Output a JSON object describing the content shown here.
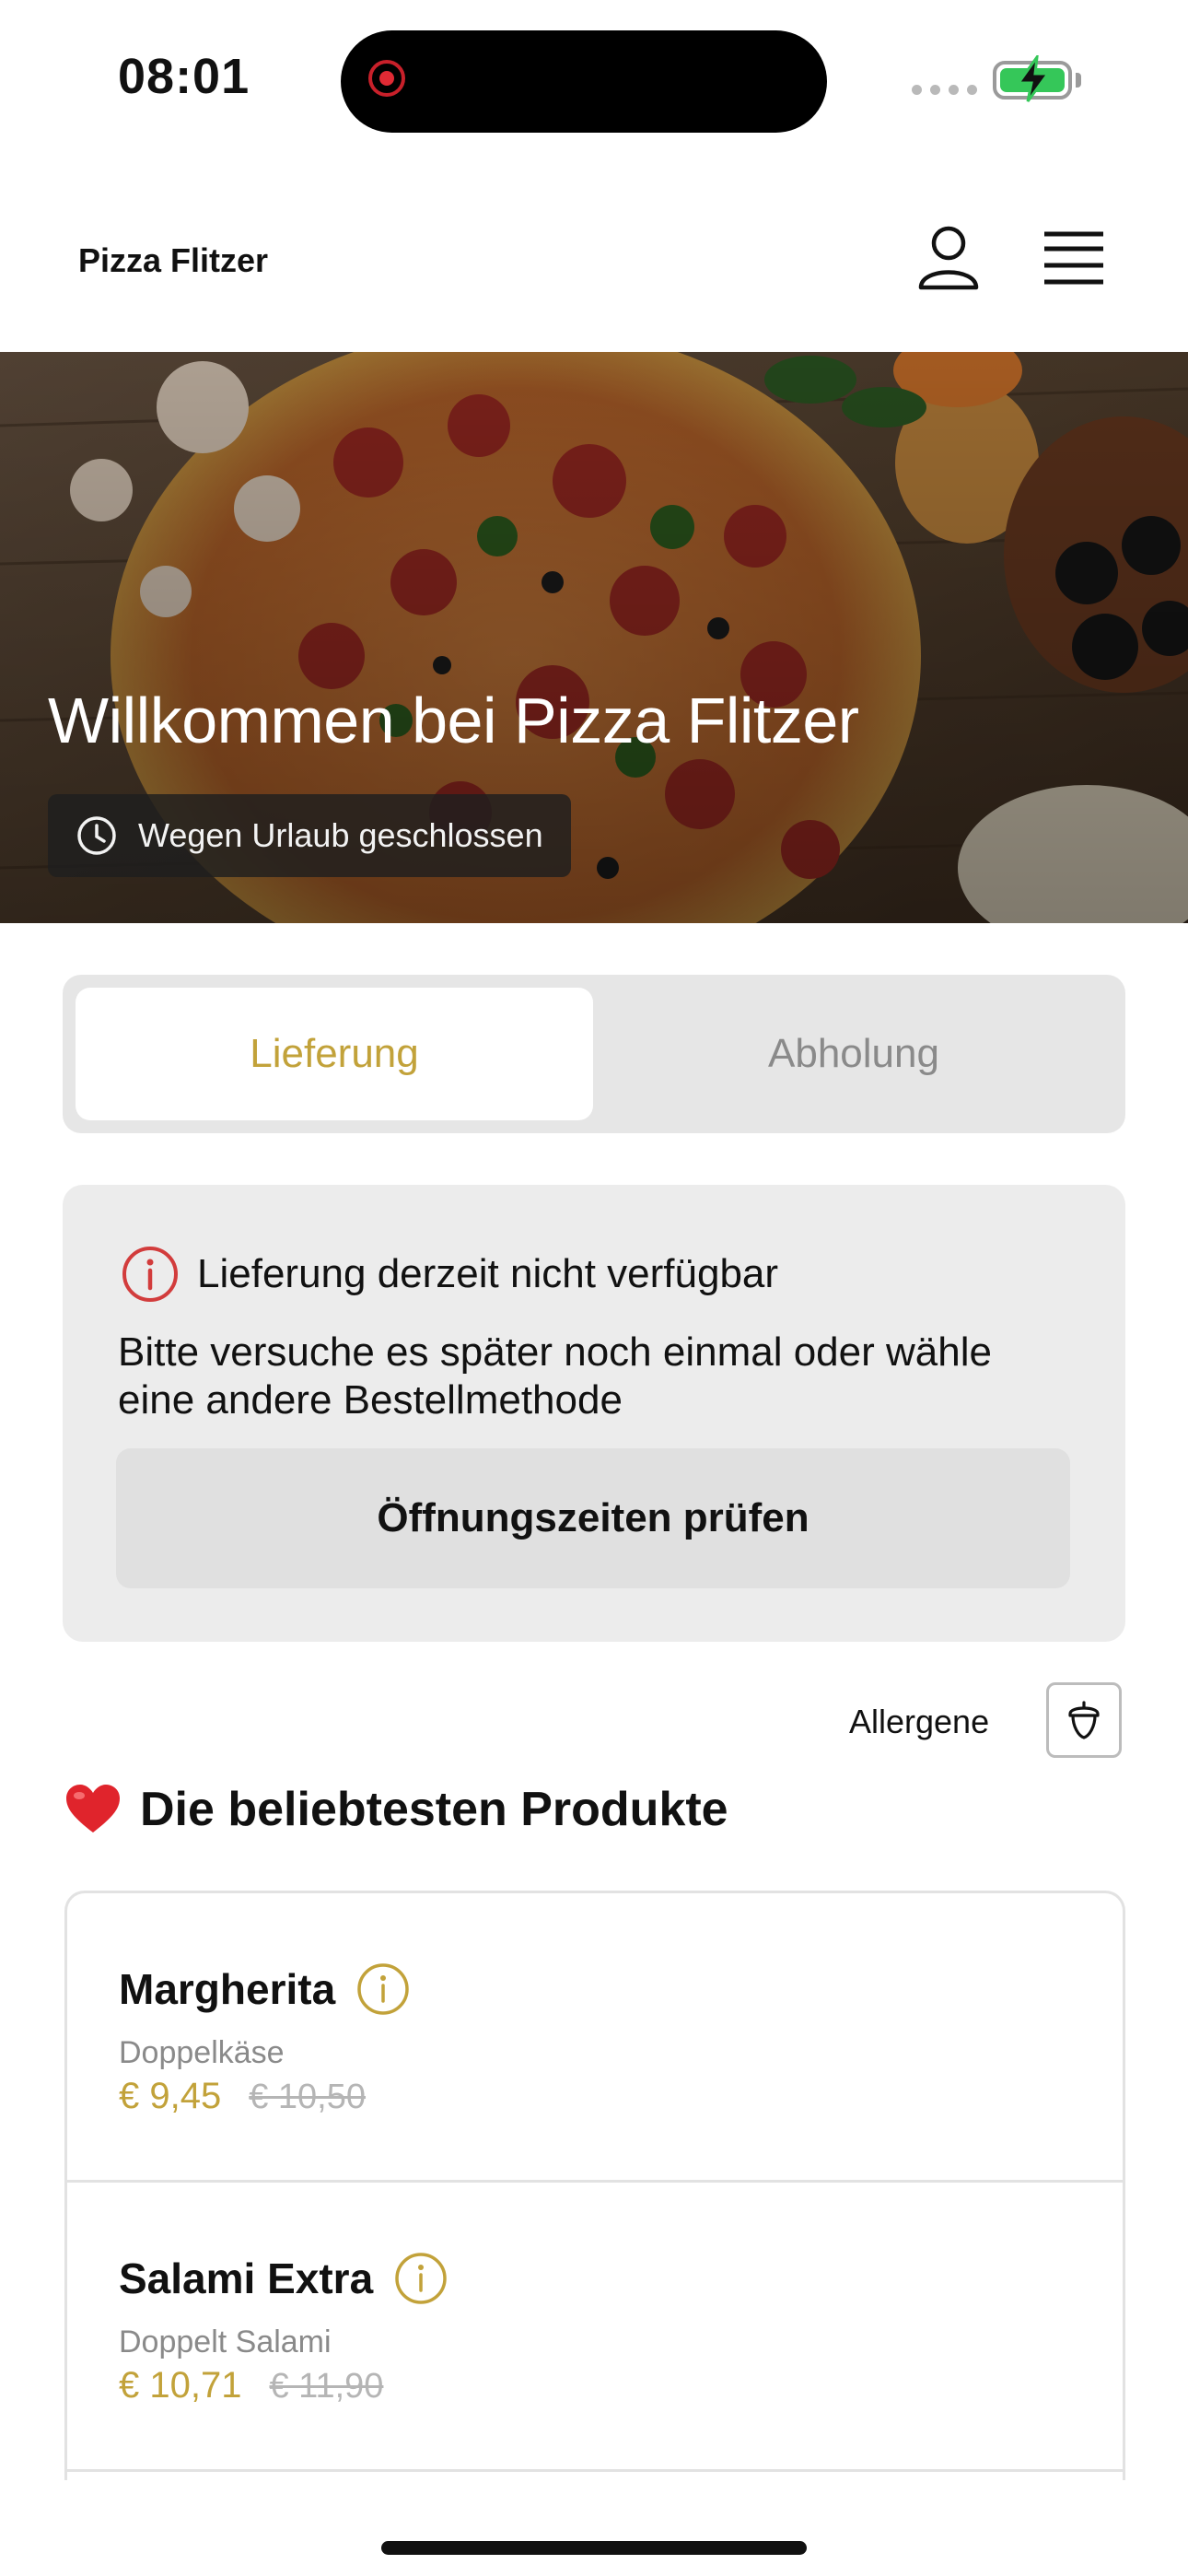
{
  "status_bar": {
    "time": "08:01"
  },
  "header": {
    "brand": "Pizza Flitzer"
  },
  "hero": {
    "title": "Willkommen bei Pizza Flitzer",
    "status": "Wegen Urlaub geschlossen"
  },
  "order_mode": {
    "delivery_label": "Lieferung",
    "pickup_label": "Abholung",
    "selected": "Lieferung"
  },
  "notice": {
    "title": "Lieferung derzeit nicht verfügbar",
    "body": "Bitte versuche es später noch einmal oder wähle eine andere Bestellmethode",
    "button_label": "Öffnungszeiten prüfen"
  },
  "allergens": {
    "label": "Allergene"
  },
  "popular": {
    "title": "Die beliebtesten Produkte",
    "products": [
      {
        "name": "Margherita",
        "description": "Doppelkäse",
        "price": "€ 9,45",
        "old_price": "€ 10,50"
      },
      {
        "name": "Salami Extra",
        "description": "Doppelt Salami",
        "price": "€ 10,71",
        "old_price": "€ 11,90"
      }
    ]
  },
  "colors": {
    "accent_gold": "#c2a23a",
    "alert_red": "#d23c3c",
    "battery_green": "#35c759"
  },
  "icons": {
    "record": "screen-recording-icon",
    "user": "user-icon",
    "menu": "hamburger-menu-icon",
    "clock": "clock-icon",
    "alert": "alert-info-icon",
    "allergen": "acorn-icon",
    "heart": "heart-icon",
    "info": "info-icon"
  }
}
